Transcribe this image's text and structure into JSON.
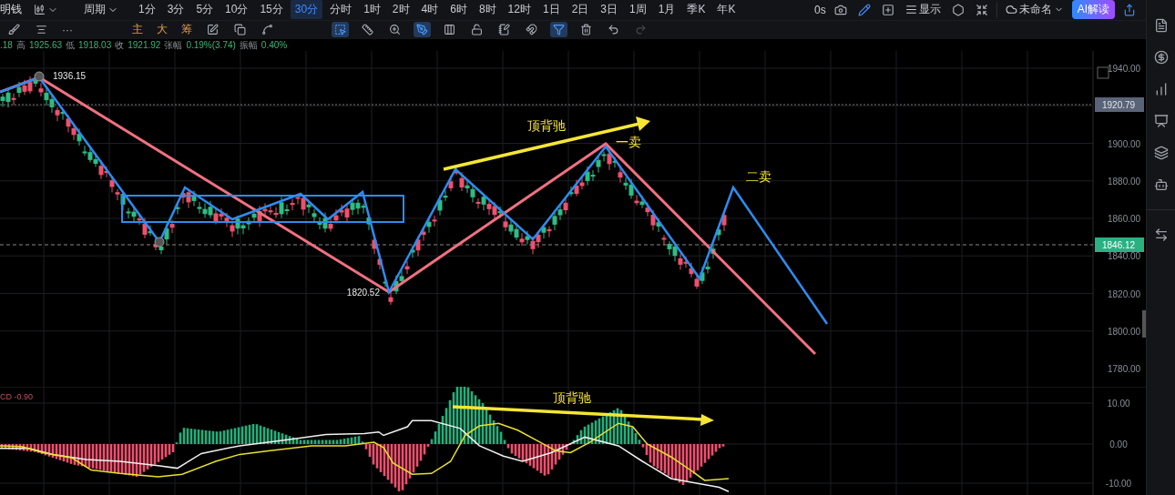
{
  "top_bar": {
    "symbol": "明钱",
    "period_label": "周期",
    "intervals": [
      {
        "label": "1分",
        "selected": false
      },
      {
        "label": "3分",
        "selected": false
      },
      {
        "label": "5分",
        "selected": false
      },
      {
        "label": "10分",
        "selected": false
      },
      {
        "label": "15分",
        "selected": false
      },
      {
        "label": "30分",
        "selected": true
      },
      {
        "label": "分时",
        "selected": false
      },
      {
        "label": "1时",
        "selected": false
      },
      {
        "label": "2时",
        "selected": false
      },
      {
        "label": "4时",
        "selected": false
      },
      {
        "label": "6时",
        "selected": false
      },
      {
        "label": "8时",
        "selected": false
      },
      {
        "label": "12时",
        "selected": false
      },
      {
        "label": "1日",
        "selected": false
      },
      {
        "label": "2日",
        "selected": false
      },
      {
        "label": "3日",
        "selected": false
      },
      {
        "label": "1周",
        "selected": false
      },
      {
        "label": "1月",
        "selected": false
      },
      {
        "label": "季K",
        "selected": false
      },
      {
        "label": "年K",
        "selected": false
      }
    ],
    "refresh": "0s",
    "display_label": "显示",
    "layout_name": "未命名",
    "ai_button": "AI解读"
  },
  "drawing_toolbar": {
    "tools": [
      {
        "kind": "icon",
        "selected": false,
        "disabled": false
      },
      {
        "kind": "icon",
        "selected": false,
        "disabled": false
      },
      {
        "kind": "text",
        "label": "···",
        "selected": false,
        "disabled": false
      },
      {
        "kind": "text",
        "label": "主",
        "selected": false,
        "disabled": false
      },
      {
        "kind": "text",
        "label": "大",
        "selected": false,
        "disabled": false
      },
      {
        "kind": "text",
        "label": "筹",
        "selected": false,
        "disabled": false
      },
      {
        "kind": "icon",
        "selected": false,
        "disabled": false
      },
      {
        "kind": "icon",
        "selected": false,
        "disabled": false
      },
      {
        "kind": "icon",
        "selected": false,
        "disabled": false
      },
      {
        "kind": "icon",
        "selected": true,
        "disabled": false
      },
      {
        "kind": "icon",
        "selected": false,
        "disabled": false
      },
      {
        "kind": "icon",
        "selected": false,
        "disabled": false
      },
      {
        "kind": "icon",
        "selected": true,
        "disabled": false
      },
      {
        "kind": "icon",
        "selected": false,
        "disabled": false
      },
      {
        "kind": "icon",
        "selected": false,
        "disabled": false
      },
      {
        "kind": "icon",
        "selected": false,
        "disabled": false
      },
      {
        "kind": "icon",
        "selected": false,
        "disabled": false
      },
      {
        "kind": "icon",
        "selected": true,
        "disabled": false
      },
      {
        "kind": "icon",
        "selected": false,
        "disabled": false
      },
      {
        "kind": "icon",
        "selected": false,
        "disabled": false
      },
      {
        "kind": "icon",
        "selected": false,
        "disabled": true
      }
    ]
  },
  "quote_line": {
    "lead": ".18",
    "fields": [
      {
        "label": "高",
        "value": "1925.63"
      },
      {
        "label": "低",
        "value": "1918.03"
      },
      {
        "label": "收",
        "value": "1921.92"
      },
      {
        "label": "张幅",
        "value": "0.19%(3.74)"
      },
      {
        "label": "振幅",
        "value": "0.40%"
      }
    ]
  },
  "price_chart": {
    "price_axis": [
      "1940.00",
      "1900.00",
      "1880.00",
      "1860.00",
      "1840.00",
      "1820.00",
      "1800.00",
      "1780.00"
    ],
    "reference_tag": "1920.79",
    "current_price_tag": "1846.12",
    "annotations": [
      {
        "kind": "high",
        "text": "1936.15"
      },
      {
        "kind": "low",
        "text": "1820.52"
      },
      {
        "kind": "divergence",
        "text": "顶背驰"
      },
      {
        "kind": "first_sell",
        "text": "一卖"
      },
      {
        "kind": "second_sell",
        "text": "二卖"
      }
    ]
  },
  "macd_pane": {
    "label": "CD -0.90",
    "axis": [
      "10.00",
      "0.00",
      "-10.00"
    ],
    "annotation": "顶背驰"
  }
}
